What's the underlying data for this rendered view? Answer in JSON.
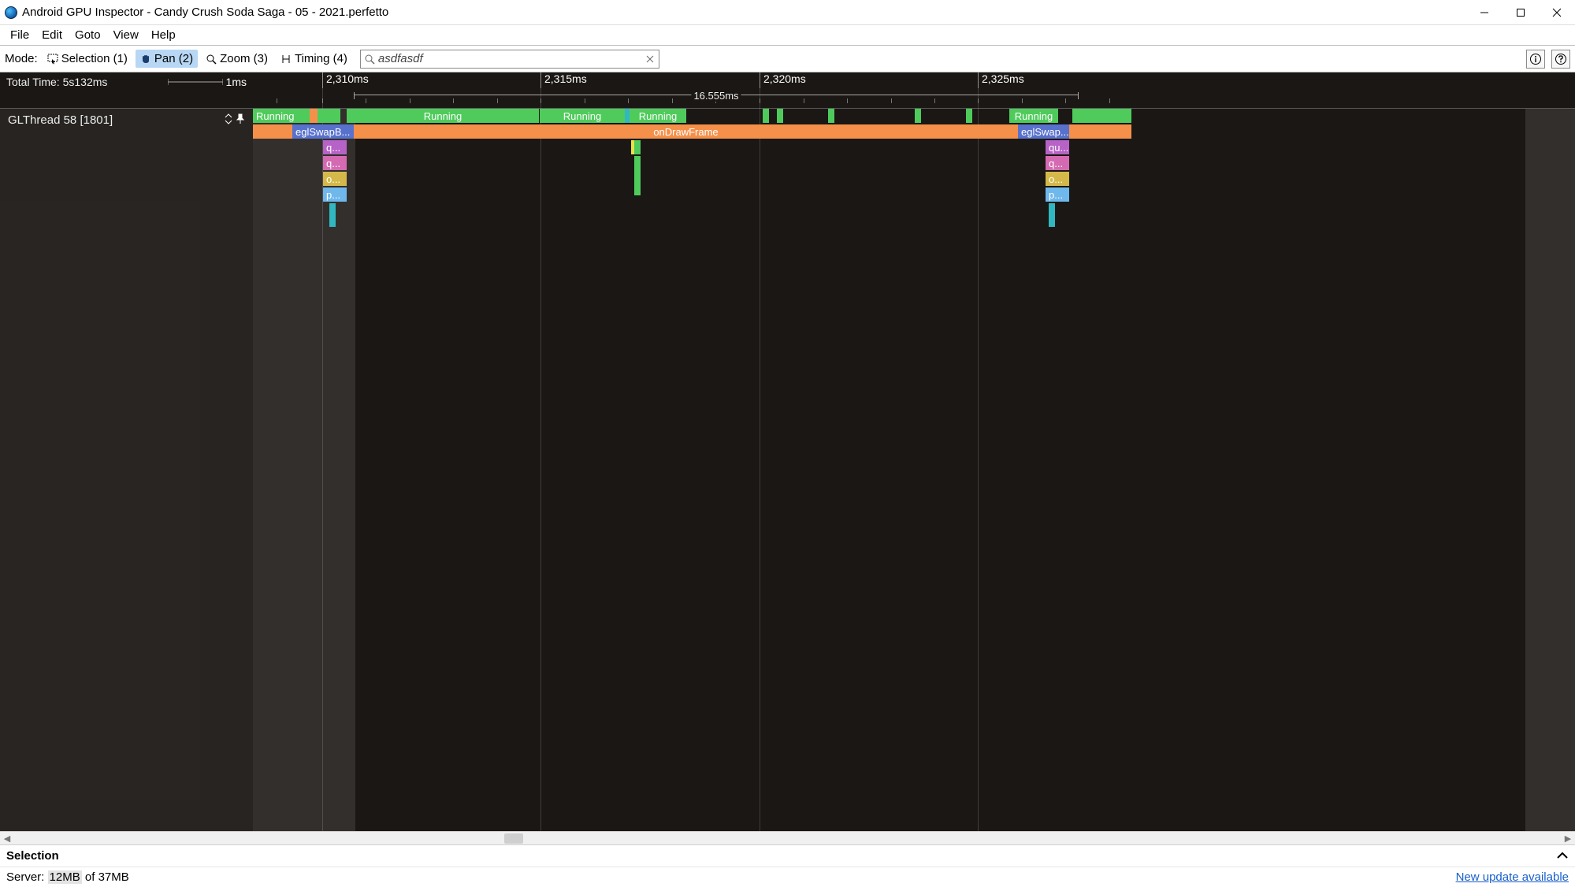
{
  "window": {
    "title": "Android GPU Inspector - Candy Crush Soda Saga - 05 - 2021.perfetto"
  },
  "menu": {
    "items": [
      "File",
      "Edit",
      "Goto",
      "View",
      "Help"
    ]
  },
  "toolbar": {
    "mode_label": "Mode:",
    "modes": {
      "selection": "Selection (1)",
      "pan": "Pan (2)",
      "zoom": "Zoom (3)",
      "timing": "Timing (4)"
    },
    "search_value": "asdfasdf"
  },
  "timeline": {
    "total_time_label": "Total Time: 5s132ms",
    "scale_label": "1ms",
    "ticks": [
      "2,310ms",
      "2,315ms",
      "2,320ms",
      "2,325ms"
    ],
    "range_label": "16.555ms",
    "track_name": "GLThread 58 [1801]",
    "labels": {
      "running": "Running",
      "eglSwapB": "eglSwapB...",
      "eglSwap2": "eglSwap...",
      "onDrawFrame": "onDrawFrame",
      "q": "q...",
      "qu": "qu...",
      "o": "o...",
      "p": "p..."
    }
  },
  "selection": {
    "title": "Selection"
  },
  "status": {
    "server_prefix": "Server:",
    "mem_used": "12MB",
    "mem_rest": "of 37MB",
    "update": "New update available"
  }
}
